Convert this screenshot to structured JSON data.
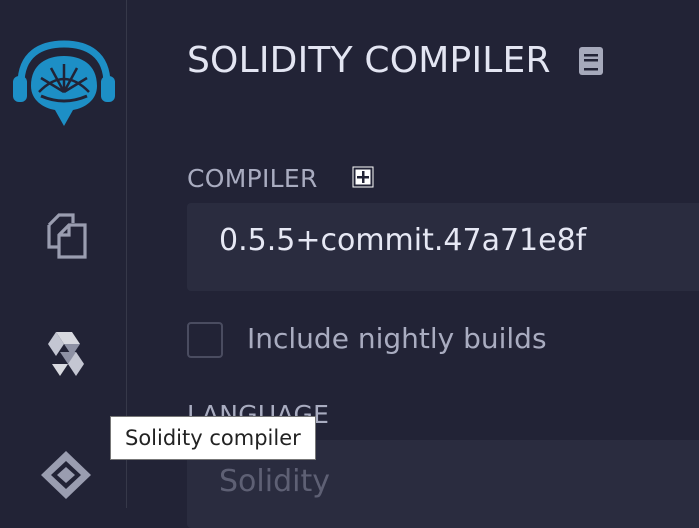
{
  "sidebar": {
    "logo_icon": "remix-logo-icon",
    "items": [
      {
        "icon": "file-explorer-icon"
      },
      {
        "icon": "solidity-compiler-icon"
      },
      {
        "icon": "deploy-run-icon"
      }
    ]
  },
  "panel": {
    "title": "SOLIDITY COMPILER",
    "title_icon": "documentation-icon"
  },
  "compiler": {
    "label": "COMPILER",
    "add_icon": "plus-square-icon",
    "selected_version": "0.5.5+commit.47a71e8f"
  },
  "nightly": {
    "label": "Include nightly builds",
    "checked": false
  },
  "language": {
    "label": "LANGUAGE",
    "selected": "Solidity"
  },
  "tooltip": {
    "text": "Solidity compiler"
  },
  "colors": {
    "background": "#222336",
    "accent": "#1d8fc6",
    "input_bg": "#2a2c3f"
  }
}
